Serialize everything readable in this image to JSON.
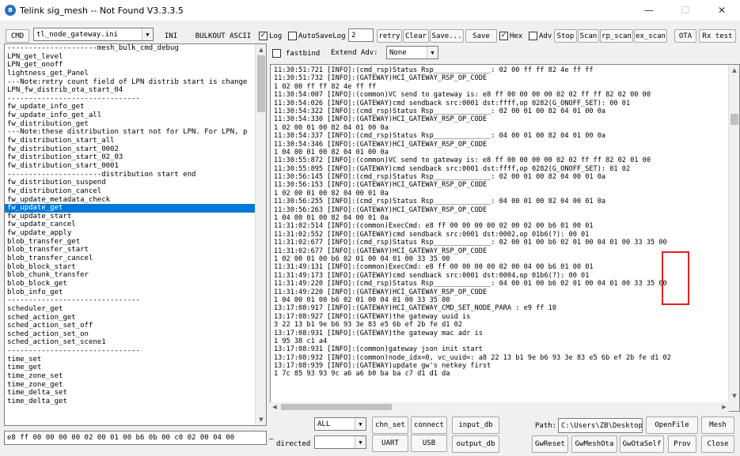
{
  "window": {
    "title": "Telink sig_mesh -- Not Found   V3.3.3.5",
    "icon": "bluetooth-icon",
    "controls": {
      "minimize": "—",
      "maximize": "☐",
      "close": "✕"
    }
  },
  "toolbar": {
    "cmd_label": "CMD",
    "ini_file": "tl_node_gateway.ini",
    "ini_label": "INI",
    "bulkout_label": "BULKOUT ASCII",
    "log_label": "Log",
    "log_checked": true,
    "autosave_label": "AutoSaveLog",
    "autosave_checked": false,
    "autosave_value": "2",
    "retry_label": "retry",
    "clear_label": "Clear",
    "save_dots_label": "Save...",
    "save_label": "Save",
    "hex_label": "Hex",
    "hex_checked": true,
    "adv_label": "Adv",
    "adv_checked": false,
    "stop_label": "Stop",
    "scan_label": "Scan",
    "rp_scan_label": "rp_scan",
    "ex_scan_label": "ex_scan",
    "ota_label": "OTA",
    "rx_test_label": "Rx test"
  },
  "options": {
    "fastbind_label": "fastbind",
    "fastbind_checked": false,
    "extend_adv_label": "Extend Adv:",
    "extend_adv_value": "None"
  },
  "cmd_list": {
    "selected_index": 19,
    "items": [
      "---------------------mesh_bulk_cmd_debug",
      "LPN_get_level",
      "LPN_get_onoff",
      "lightness_get_Panel",
      "---Note:retry count field of LPN distrib start is change",
      "LPN_fw_distrib_ota_start_04",
      "-------------------------------",
      "fw_update_info_get",
      "fw_update_info_get_all",
      "fw_distribution_get",
      "---Note:these distribution start not for LPN. For LPN, p",
      "fw_distribution_start_all",
      "fw_distribution_start_0002",
      "fw_distribution_start_02_03",
      "fw_distribution_start_0001",
      "----------------------distribution start end",
      "fw_distribution_suspend",
      "fw_distribution_cancel",
      "fw_update_metadata_check",
      "fw_update_get",
      "fw_update_start",
      "fw_update_cancel",
      "fw_update_apply",
      "blob_transfer_get",
      "blob_transfer_start",
      "blob_transfer_cancel",
      "blob_block_start",
      "blob_chunk_transfer",
      "blob_block_get",
      "blob_info_get",
      "-------------------------------",
      "scheduler_get",
      "sched_action_get",
      "sched_action_set_off",
      "sched_action_set_on",
      "sched_action_set_scene1",
      "-------------------------------",
      "time_set",
      "time_get",
      "time_zone_set",
      "time_zone_get",
      "time_delta_set",
      "time_delta_get"
    ]
  },
  "log_lines": [
    "11:30:51:721 [INFO]:(cmd_rsp)Status Rsp______________: 02 00 ff ff 82 4e ff ff",
    "11:30:51:732 [INFO]:(GATEWAY)HCI_GATEWAY_RSP_OP_CODE",
    "1 02 00 ff ff 82 4e ff ff",
    "11:30:54:007 [INFO]:(common)VC send to gateway is: e8 ff 00 00 00 00 02 02 ff ff 82 02 00 00",
    "11:30:54:026 [INFO]:(GATEWAY)cmd sendback src:0001 dst:ffff,op 0282(G_ONOFF_SET): 00 01",
    "11:30:54:322 [INFO]:(cmd_rsp)Status Rsp______________: 02 00 01 00 82 04 01 00 0a",
    "11:30:54:330 [INFO]:(GATEWAY)HCI_GATEWAY_RSP_OP_CODE",
    "1 02 00 01 00 82 04 01 00 0a",
    "11:30:54:337 [INFO]:(cmd_rsp)Status Rsp______________: 04 00 01 00 82 04 01 00 0a",
    "11:30:54:346 [INFO]:(GATEWAY)HCI_GATEWAY_RSP_OP_CODE",
    "1 04 00 01 00 82 04 01 00 0a",
    "11:30:55:872 [INFO]:(common)VC send to gateway is: e8 ff 00 00 00 00 02 02 ff ff 82 02 01 00",
    "11:30:55:895 [INFO]:(GATEWAY)cmd sendback src:0001 dst:ffff,op 0282(G_ONOFF_SET): 01 02",
    "11:30:56:145 [INFO]:(cmd_rsp)Status Rsp______________: 02 00 01 00 82 04 00 01 0a",
    "11:30:56:153 [INFO]:(GATEWAY)HCI_GATEWAY_RSP_OP_CODE",
    "1 02 00 01 00 82 04 00 01 0a",
    "11:30:56:255 [INFO]:(cmd_rsp)Status Rsp______________: 04 00 01 00 82 04 00 01 0a",
    "11:30:56:263 [INFO]:(GATEWAY)HCI_GATEWAY_RSP_OP_CODE",
    "1 04 00 01 00 82 04 00 01 0a",
    "11:31:02:514 [INFO]:(common)ExecCmd: e8 ff 00 00 00 00 02 00 02 00 b6 01 00 01",
    "11:31:02:552 [INFO]:(GATEWAY)cmd sendback src:0001 dst:0002,op 01b6(?): 00 01",
    "11:31:02:677 [INFO]:(cmd_rsp)Status Rsp______________: 02 00 01 00 b6 02 01 00 04 01 00 33 35 00",
    "11:31:02:677 [INFO]:(GATEWAY)HCI_GATEWAY_RSP_OP_CODE",
    "1 02 00 01 00 b6 02 01 00 04 01 00 33 35 00",
    "11:31:49:131 [INFO]:(common)ExecCmd: e8 ff 00 00 00 00 02 00 04 00 b6 01 00 01",
    "11:31:49:173 [INFO]:(GATEWAY)cmd sendback src:0001 dst:0004,op 01b6(?): 00 01",
    "11:31:49:220 [INFO]:(cmd_rsp)Status Rsp______________: 04 00 01 00 b6 02 01 00 04 01 00 33 35 00",
    "11:31:49:220 [INFO]:(GATEWAY)HCI_GATEWAY_RSP_OP_CODE",
    "1 04 00 01 00 b6 02 01 00 04 01 00 33 35 00",
    "13:17:08:917 [INFO]:(GATEWAY)HCI_GATEWAY_CMD_SET_NODE_PARA : e9 ff 10",
    "13:17:08:927 [INFO]:(GATEWAY)the gateway uuid is",
    "3 22 13 b1 9e b6 93 3e 83 e5 6b ef 2b fe d1 02",
    "13:17:08:931 [INFO]:(GATEWAY)the gateway mac adr is",
    "1 95 38 c1 a4",
    "13:17:08:931 [INFO]:(common)gateway json init start",
    "13:17:08:932 [INFO]:(common)node_idx=0, vc_uuid=: a8 22 13 b1 9e b6 93 3e 83 e5 6b ef 2b fe d1 02",
    "13:17:08:939 [INFO]:(GATEWAY)update gw's netkey first",
    "1 7c 85 93 93 9c a6 a6 b0 ba ba c7 d1 d1 da"
  ],
  "bottom": {
    "command_input": "e8 ff 00 00 00 00 02 00 01 00 b6 0b 00 c0 02 00 04 00",
    "all_value": "ALL",
    "direction_label": "directed",
    "chn_set_label": "chn_set",
    "connect_label": "connect",
    "input_db_label": "input_db",
    "uart_label": "UART",
    "usb_label": "USB",
    "output_db_label": "output_db",
    "path_label": "Path:",
    "path_value": "C:\\Users\\ZB\\Desktop",
    "openfile_label": "OpenFile",
    "mesh_label": "Mesh",
    "gwreset_label": "GwReset",
    "gwmeshota_label": "GwMeshOta",
    "gwotaself_label": "GwOtaSelf",
    "prov_label": "Prov",
    "close_label": "Close"
  },
  "colors": {
    "selection": "#0078d7",
    "highlight_box": "#e02020"
  }
}
